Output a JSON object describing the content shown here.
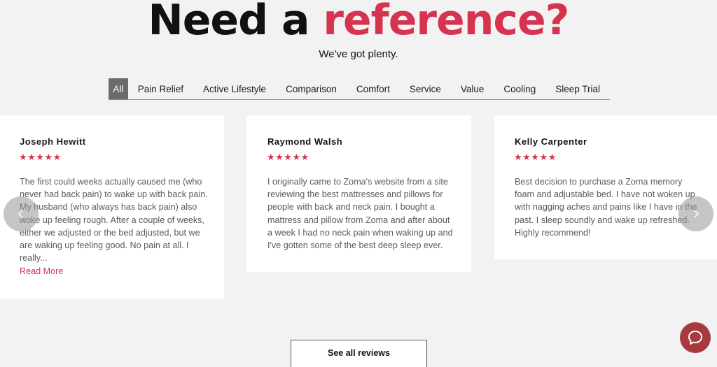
{
  "header": {
    "title_part1": "Need a ",
    "title_part2": "reference?",
    "subtitle": "We've got plenty."
  },
  "tabs": [
    {
      "label": "All",
      "active": true
    },
    {
      "label": "Pain Relief"
    },
    {
      "label": "Active Lifestyle"
    },
    {
      "label": "Comparison"
    },
    {
      "label": "Comfort"
    },
    {
      "label": "Service"
    },
    {
      "label": "Value"
    },
    {
      "label": "Cooling"
    },
    {
      "label": "Sleep Trial"
    }
  ],
  "reviews": [
    {
      "name": "Joseph Hewitt",
      "stars": "★★★★★",
      "lines": [
        "The first could weeks actually caused me (who",
        "never had back pain) to wake up with back pain.",
        "My husband (who always has back pain) also",
        "woke up feeling rough. After a couple of weeks,",
        "either we adjusted or the bed adjusted, but we",
        "are waking up feeling good. No pain at all. I",
        "really..."
      ],
      "read_more": "Read More"
    },
    {
      "name": "Raymond Walsh",
      "stars": "★★★★★",
      "lines": [
        "I originally came to Zoma's website from a site",
        "reviewing the best mattresses and pillows for",
        "people with back and neck pain. I bought a",
        "mattress and pillow from Zoma and after about",
        "a week I had no neck pain when waking up and",
        "I've gotten some of the best deep sleep ever."
      ]
    },
    {
      "name": "Kelly Carpenter",
      "stars": "★★★★★",
      "lines": [
        "Best decision to purchase a Zoma memory",
        "foam and adjustable bed. I have not woken up",
        "with nagging aches and pains like I have in the",
        "past. I sleep soundly and wake up refreshed.",
        "Highly recommend!"
      ]
    }
  ],
  "carousel": {
    "prev_icon": "chevron-left-icon",
    "next_icon": "chevron-right-icon"
  },
  "footer": {
    "see_all_label": "See all reviews"
  },
  "chat": {
    "icon": "chat-bubble-icon"
  },
  "colors": {
    "accent": "#d5334f",
    "background": "#f2f2f2",
    "active_tab": "#6b6b6b",
    "chat_button": "#a83a3f"
  }
}
